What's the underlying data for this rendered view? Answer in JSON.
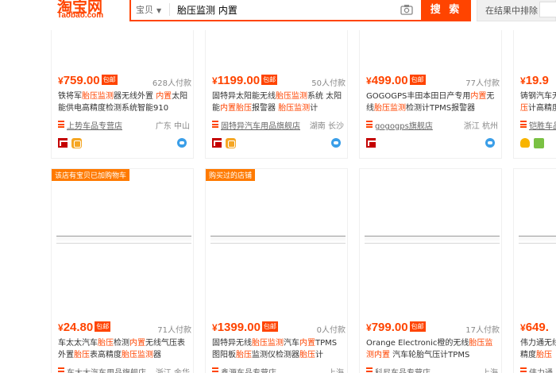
{
  "header": {
    "logo": "淘宝网",
    "logo_sub": "Taobao.com",
    "search_scope": "宝贝",
    "search_query": "胎压监测 内置",
    "search_button": "搜 索",
    "refine_label": "在结果中排除"
  },
  "products": [
    {
      "price_cur": "¥",
      "price": "759.00",
      "free_shipping": "包邮",
      "paid": "628人付款",
      "title_segments": [
        {
          "t": "铁将军",
          "h": false
        },
        {
          "t": "胎压监测",
          "h": true
        },
        {
          "t": "器无线外置 ",
          "h": false
        },
        {
          "t": "内置",
          "h": true
        },
        {
          "t": "太阳能供电高精度检测系统智能910",
          "h": false
        }
      ],
      "shop": "上势车品专营店",
      "location": "广东 中山"
    },
    {
      "price_cur": "¥",
      "price": "1199.00",
      "free_shipping": "包邮",
      "paid": "50人付款",
      "title_segments": [
        {
          "t": "固特异太阳能无线",
          "h": false
        },
        {
          "t": "胎压监测",
          "h": true
        },
        {
          "t": "系统 太阳能",
          "h": false
        },
        {
          "t": "内置",
          "h": true
        },
        {
          "t": "胎压",
          "h": true
        },
        {
          "t": "报警器 ",
          "h": false
        },
        {
          "t": "胎压监测",
          "h": true
        },
        {
          "t": "计",
          "h": false
        }
      ],
      "shop": "固特异汽车用品旗舰店",
      "location": "湖南 长沙"
    },
    {
      "price_cur": "¥",
      "price": "499.00",
      "free_shipping": "包邮",
      "paid": "77人付款",
      "title_segments": [
        {
          "t": "GOGOGPS丰田本田日产专用",
          "h": false
        },
        {
          "t": "内置",
          "h": true
        },
        {
          "t": "无线",
          "h": false
        },
        {
          "t": "胎压监测",
          "h": true
        },
        {
          "t": "检测计TPMS报警器",
          "h": false
        }
      ],
      "shop": "gogogps旗舰店",
      "location": "浙江 杭州"
    },
    {
      "price_cur": "¥",
      "price": "19.9",
      "free_shipping": "",
      "paid": "",
      "title_segments": [
        {
          "t": "铸钢汽车无",
          "h": false
        },
        {
          "t": "胎压",
          "h": true
        },
        {
          "t": "计高精度",
          "h": false
        }
      ],
      "shop": "铠胜车品",
      "location": ""
    },
    {
      "ribbon": "该店有宝贝已加购物车",
      "price_cur": "¥",
      "price": "24.80",
      "free_shipping": "包邮",
      "paid": "71人付款",
      "title_segments": [
        {
          "t": "车太太汽车",
          "h": false
        },
        {
          "t": "胎压",
          "h": true
        },
        {
          "t": "检测",
          "h": false
        },
        {
          "t": "内置",
          "h": true
        },
        {
          "t": "无线气压表外置",
          "h": false
        },
        {
          "t": "胎压",
          "h": true
        },
        {
          "t": "表高精度",
          "h": false
        },
        {
          "t": "胎压监测",
          "h": true
        },
        {
          "t": "器",
          "h": false
        }
      ],
      "shop": "车太太汽车用品旗舰店",
      "location": "浙江 金华"
    },
    {
      "ribbon": "购买过的店铺",
      "price_cur": "¥",
      "price": "1399.00",
      "free_shipping": "包邮",
      "paid": "0人付款",
      "title_segments": [
        {
          "t": "固特异无线",
          "h": false
        },
        {
          "t": "胎压监测",
          "h": true
        },
        {
          "t": "汽车",
          "h": false
        },
        {
          "t": "内置",
          "h": true
        },
        {
          "t": "TPMS图阳板",
          "h": false
        },
        {
          "t": "胎压",
          "h": true
        },
        {
          "t": "监测仪检测器",
          "h": false
        },
        {
          "t": "胎压",
          "h": true
        },
        {
          "t": "计",
          "h": false
        }
      ],
      "shop": "鑫源车品专营店",
      "location": "上海"
    },
    {
      "price_cur": "¥",
      "price": "799.00",
      "free_shipping": "包邮",
      "paid": "17人付款",
      "title_segments": [
        {
          "t": "Orange Electronic橙的无线",
          "h": false
        },
        {
          "t": "胎压监测",
          "h": true
        },
        {
          "t": "内置",
          "h": true
        },
        {
          "t": " 汽车轮胎气压计TPMS",
          "h": false
        }
      ],
      "shop": "科尼车品专营店",
      "location": "上海"
    },
    {
      "price_cur": "¥",
      "price": "649.",
      "free_shipping": "",
      "paid": "",
      "title_segments": [
        {
          "t": "伟力通无",
          "h": false
        },
        {
          "t": "线",
          "h": false
        },
        {
          "t": "高精度",
          "h": false
        },
        {
          "t": "胎压",
          "h": true
        }
      ],
      "shop": "伟力通",
      "location": ""
    }
  ],
  "colors": {
    "brand": "#ff4400",
    "ribbon": "#ff7a00",
    "wangwang": "#3a9ee8",
    "tmall": "#c40000"
  }
}
